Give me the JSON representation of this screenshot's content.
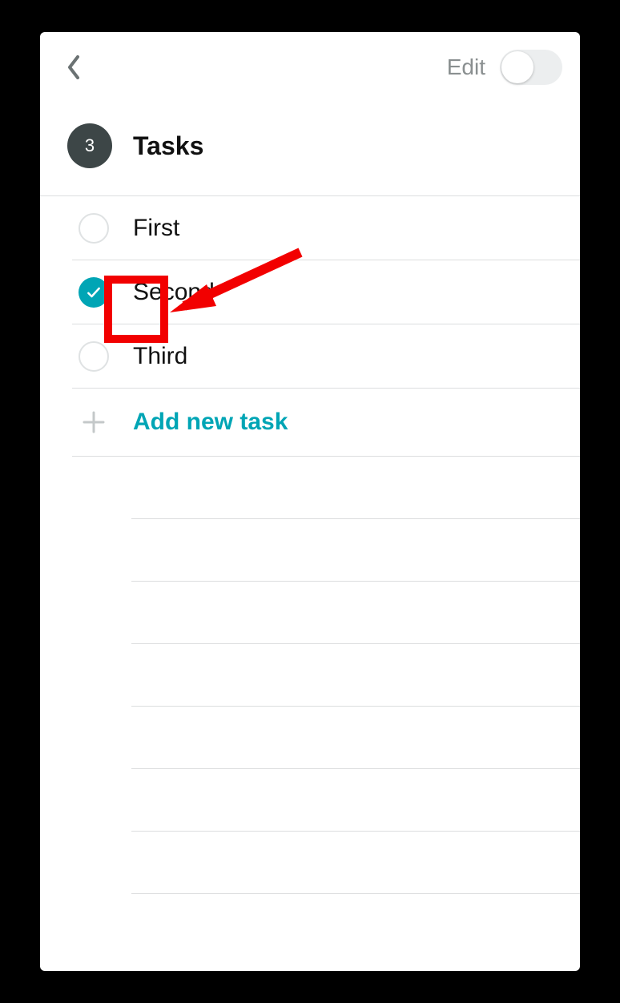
{
  "header": {
    "edit_label": "Edit",
    "toggle_on": false
  },
  "section": {
    "count": "3",
    "title": "Tasks"
  },
  "tasks": [
    {
      "label": "First",
      "checked": false
    },
    {
      "label": "Second",
      "checked": true
    },
    {
      "label": "Third",
      "checked": false
    }
  ],
  "add_task_label": "Add new task",
  "empty_slot_count": 7,
  "annotation": {
    "highlight_target": "task-checkbox-1",
    "arrow": true
  },
  "colors": {
    "accent": "#00a5b5",
    "annotation": "#f20000"
  }
}
